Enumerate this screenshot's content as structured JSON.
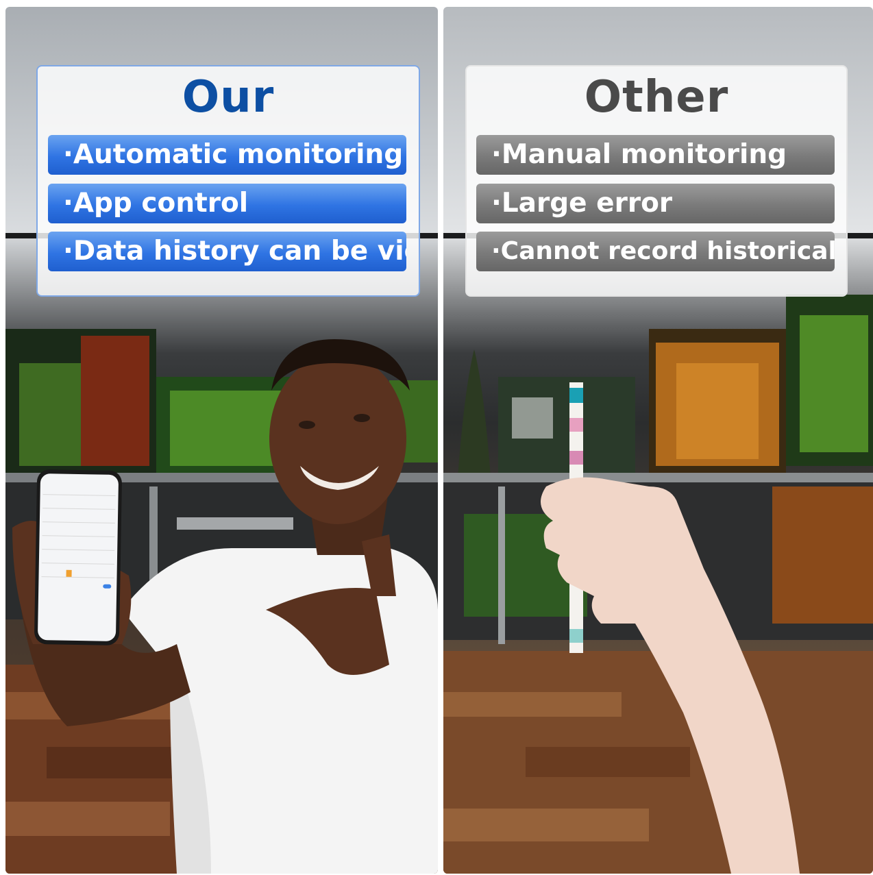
{
  "left_card": {
    "title": "Our",
    "items": [
      "·Automatic monitoring",
      "·App control",
      "·Data history can be viewed"
    ]
  },
  "right_card": {
    "title": "Other",
    "items": [
      "·Manual monitoring",
      "·Large error",
      "·Cannot record historical data"
    ]
  },
  "colors": {
    "our_title": "#0d4fa3",
    "our_bar": "#2f74e3",
    "other_title": "#4a4a4a",
    "other_bar": "#7a7a7a"
  }
}
